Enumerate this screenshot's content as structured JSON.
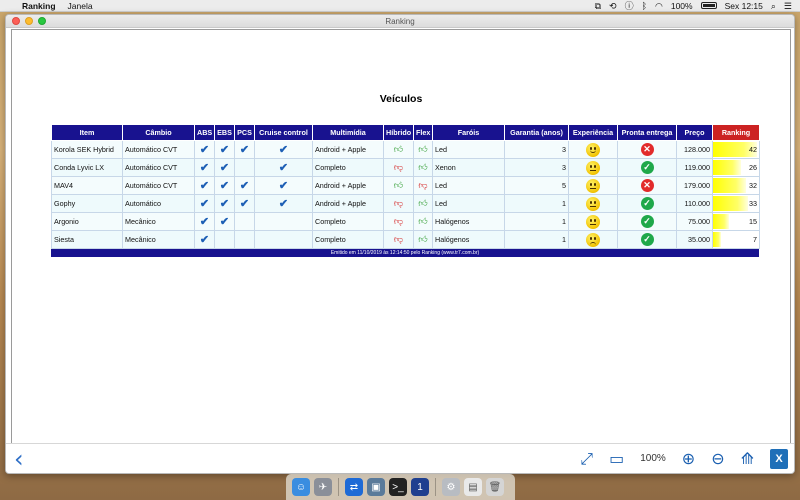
{
  "menubar": {
    "app_name": "Ranking",
    "menu_janela": "Janela",
    "battery": "100%",
    "clock": "Sex 12:15"
  },
  "window": {
    "title": "Ranking"
  },
  "report": {
    "title": "Veículos",
    "footer": "Emitido em 11/10/2019 às 12:14:50 pelo Ranking (www.tr7.com.br)"
  },
  "table": {
    "headers": [
      "Item",
      "Câmbio",
      "ABS",
      "EBS",
      "PCS",
      "Cruise control",
      "Multimídia",
      "Híbrido",
      "Flex",
      "Faróis",
      "Garantia (anos)",
      "Experiência",
      "Pronta entrega",
      "Preço",
      "Ranking"
    ],
    "rows": [
      {
        "item": "Korola SEK Hybrid",
        "cambio": "Automático CVT",
        "abs": true,
        "ebs": true,
        "pcs": true,
        "cruise": true,
        "multimidia": "Android + Apple",
        "hibrido": true,
        "flex": true,
        "farois": "Led",
        "garantia": "3",
        "experiencia": "happy",
        "pronta": false,
        "preco": "128.000",
        "ranking": "42",
        "rank_fraction": 0.95
      },
      {
        "item": "Conda Lyvic LX",
        "cambio": "Automático CVT",
        "abs": true,
        "ebs": true,
        "pcs": false,
        "cruise": true,
        "multimidia": "Completo",
        "hibrido": false,
        "flex": true,
        "farois": "Xenon",
        "garantia": "3",
        "experiencia": "neutral",
        "pronta": true,
        "preco": "119.000",
        "ranking": "26",
        "rank_fraction": 0.6
      },
      {
        "item": "MAV4",
        "cambio": "Automático CVT",
        "abs": true,
        "ebs": true,
        "pcs": true,
        "cruise": true,
        "multimidia": "Android + Apple",
        "hibrido": true,
        "flex": false,
        "farois": "Led",
        "garantia": "5",
        "experiencia": "neutral",
        "pronta": false,
        "preco": "179.000",
        "ranking": "32",
        "rank_fraction": 0.72
      },
      {
        "item": "Gophy",
        "cambio": "Automático",
        "abs": true,
        "ebs": true,
        "pcs": true,
        "cruise": true,
        "multimidia": "Android + Apple",
        "hibrido": false,
        "flex": true,
        "farois": "Led",
        "garantia": "1",
        "experiencia": "neutral",
        "pronta": true,
        "preco": "110.000",
        "ranking": "33",
        "rank_fraction": 0.75
      },
      {
        "item": "Argonio",
        "cambio": "Mecânico",
        "abs": true,
        "ebs": true,
        "pcs": false,
        "cruise": false,
        "multimidia": "Completo",
        "hibrido": false,
        "flex": true,
        "farois": "Halógenos",
        "garantia": "1",
        "experiencia": "neutral",
        "pronta": true,
        "preco": "75.000",
        "ranking": "15",
        "rank_fraction": 0.35
      },
      {
        "item": "Siesta",
        "cambio": "Mecânico",
        "abs": true,
        "ebs": false,
        "pcs": false,
        "cruise": false,
        "multimidia": "Completo",
        "hibrido": false,
        "flex": true,
        "farois": "Halógenos",
        "garantia": "1",
        "experiencia": "sad",
        "pronta": true,
        "preco": "35.000",
        "ranking": "7",
        "rank_fraction": 0.18
      }
    ]
  },
  "toolbar": {
    "zoom": "100%"
  },
  "colors": {
    "header_bg": "#18128f",
    "ranking_header": "#cc2222",
    "check": "#1d5fb5",
    "ranking_bar": "#ffff00"
  }
}
